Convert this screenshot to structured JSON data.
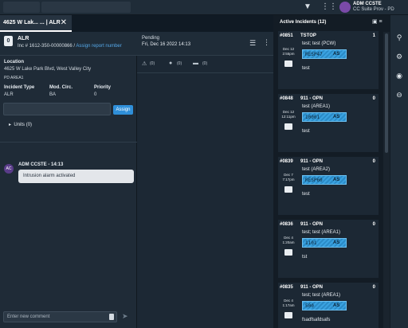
{
  "header": {
    "user_initials": "ADM CCSTE",
    "user_org": "CC Suite Prov - PD"
  },
  "tab": {
    "label": "4625 W Lak... ... | ALR"
  },
  "incident": {
    "badge": "0",
    "type": "ALR",
    "number_prefix": "Inc # 1612-350-00000866 / ",
    "assign_link": "Assign report number",
    "status": "Pending",
    "date": "Fri, Dec 16 2022 14:13"
  },
  "location": {
    "label": "Location",
    "address": "4625 W Lake Park Blvd, West Valley City",
    "area": "PD AREA1"
  },
  "fields": {
    "incident_type_label": "Incident Type",
    "incident_type": "ALR",
    "mod_circ_label": "Mod. Circ.",
    "mod_circ": "BA",
    "priority_label": "Priority",
    "priority": "0"
  },
  "assign": {
    "button": "Assign"
  },
  "units": {
    "label": "Units (0)"
  },
  "message": {
    "avatar": "AC",
    "header": "ADM CCSTE - 14:13",
    "text": "Intrusion alarm activated"
  },
  "comment": {
    "placeholder": "Enter new comment"
  },
  "mid_counts": {
    "alerts": "(0)",
    "people": "(0)",
    "vehicles": "(0)"
  },
  "active_incidents": {
    "title": "Active Incidents (12)",
    "cards": [
      {
        "id": "#0851",
        "type": "TSTOP",
        "count": "1",
        "date": "Dec 12\n2:55pm",
        "line1": "test; test (PCW)",
        "unit": "RESP47",
        "unit_status": "AS",
        "note": "test"
      },
      {
        "id": "#0848",
        "type": "911 - OPN",
        "count": "0",
        "date": "Dec 12\n12:11pm",
        "line1": "test (AREA1)",
        "unit": "10001",
        "unit_status": "AS",
        "note": "test"
      },
      {
        "id": "#0839",
        "type": "911 - OPN",
        "count": "0",
        "date": "Dec 7\n7:17pm",
        "line1": "test (AREA2)",
        "unit": "RESP60",
        "unit_status": "AS",
        "note": "test"
      },
      {
        "id": "#0836",
        "type": "911 - OPN",
        "count": "0",
        "date": "Dec 4\n1:20am",
        "line1": "test; test (AREA1)",
        "unit": "1101",
        "unit_status": "AS",
        "note": "tst"
      },
      {
        "id": "#0835",
        "type": "911 - OPN",
        "count": "0",
        "date": "Dec 4\n1:17am",
        "line1": "test; test (AREA1)",
        "unit": "500",
        "unit_status": "AS",
        "note": "fsadfsafdsafs"
      }
    ]
  }
}
